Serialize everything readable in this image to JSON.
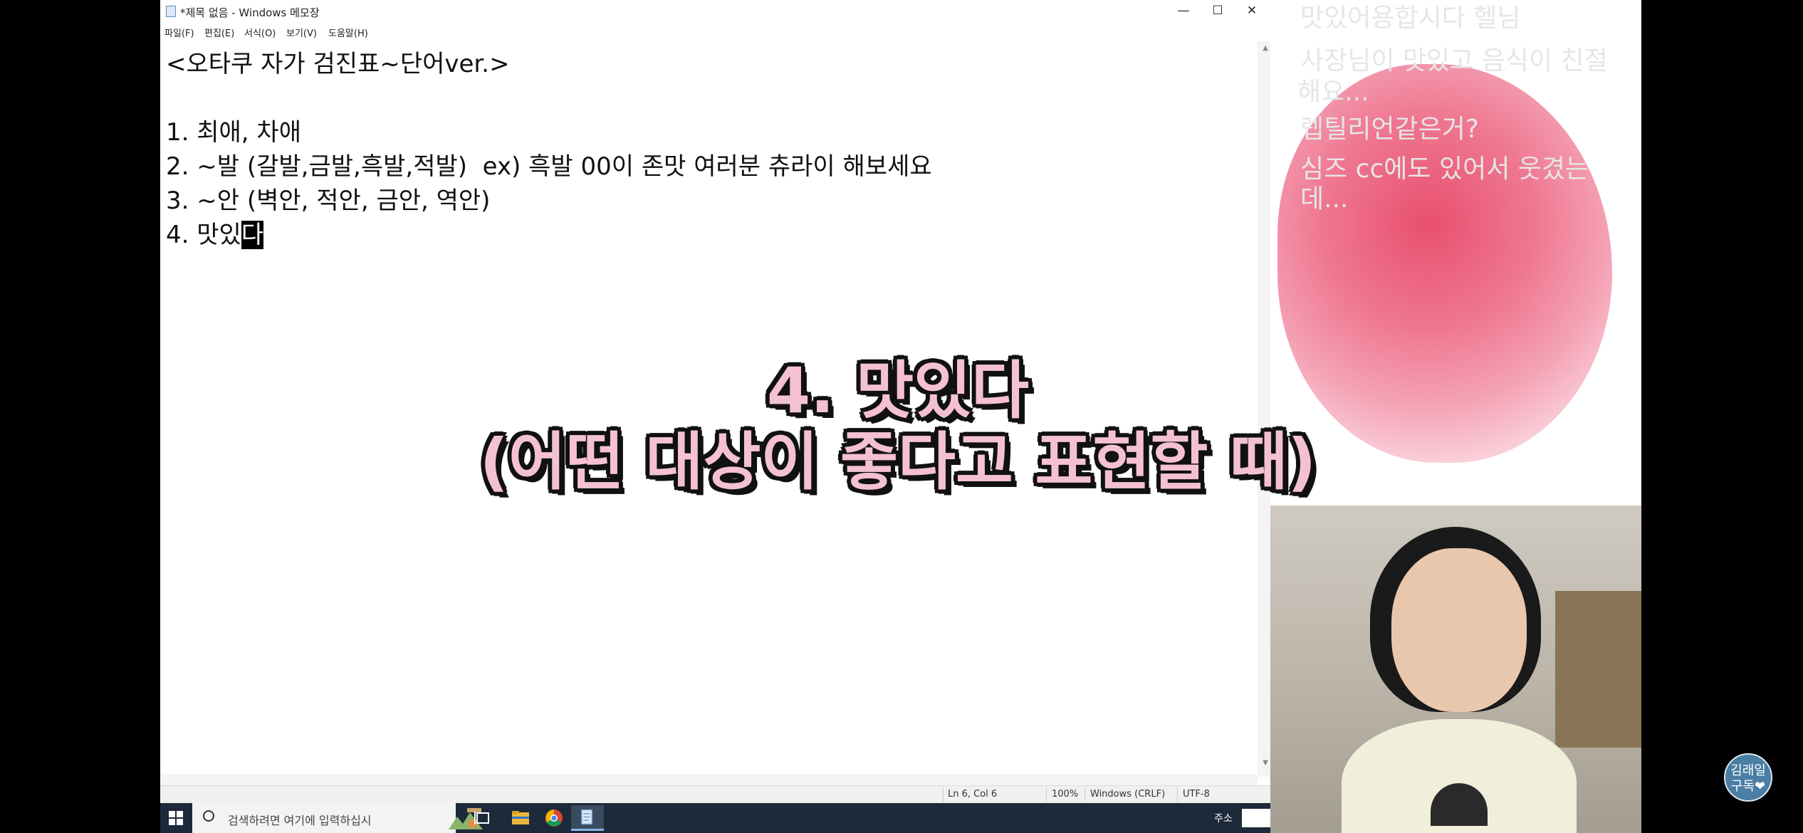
{
  "window": {
    "title": "*제목 없음 - Windows 메모장",
    "minimize": "—",
    "maximize": "☐",
    "close": "✕"
  },
  "menu": [
    "파일(F)",
    "편집(E)",
    "서식(O)",
    "보기(V)",
    "도움말(H)"
  ],
  "document": {
    "lines": [
      "<오타쿠 자가 검진표~단어ver.>",
      "",
      "1. 최애, 차애",
      "2. ~발 (갈발,금발,흑발,적발)  ex) 흑발 00이 존맛 여러분 츄라이 해보세요",
      "3. ~안 (벽안, 적안, 금안, 역안)",
      "4. 맛있"
    ],
    "selected_text": "다"
  },
  "status": {
    "position": "Ln 6, Col 6",
    "zoom": "100%",
    "line_ending": "Windows (CRLF)",
    "encoding": "UTF-8"
  },
  "taskbar": {
    "search_placeholder": "검색하려면 여기에 입력하십시",
    "tray_label": "주소"
  },
  "caption": {
    "line1": "4. 맛있다",
    "line2": "(어떤 대상이 좋다고 표현할 때)"
  },
  "chat": {
    "lines": [
      "맛있어용합시다 헬님",
      "사장님이 맛있고 음식이 친절",
      "해요...",
      "렙틸리언같은거?",
      "심즈 cc에도 있어서 웃겼는",
      "데..."
    ]
  },
  "badge": {
    "line1": "김래일",
    "line2": "구독❤"
  }
}
